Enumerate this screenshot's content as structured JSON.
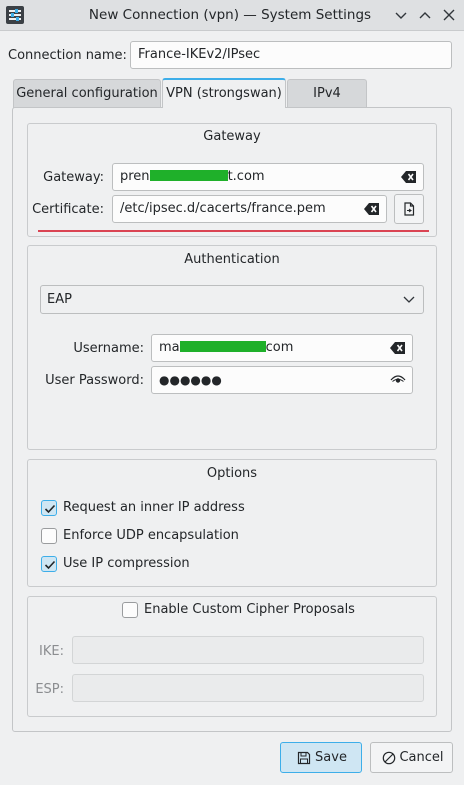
{
  "window": {
    "title": "New Connection (vpn) — System Settings",
    "icon": "system-settings-icon",
    "controls": [
      "chevron-down-icon",
      "chevron-up-icon",
      "close-icon"
    ]
  },
  "connection": {
    "label": "Connection name:",
    "value": "France-IKEv2/IPsec"
  },
  "tabs": [
    {
      "label": "General configuration",
      "active": false
    },
    {
      "label": "VPN (strongswan)",
      "active": true
    },
    {
      "label": "IPv4",
      "active": false
    }
  ],
  "gateway_group": {
    "title": "Gateway",
    "gateway_label": "Gateway:",
    "gateway_value_start": "pren",
    "gateway_value_end": "t.com",
    "certificate_label": "Certificate:",
    "certificate_value": "/etc/ipsec.d/cacerts/france.pem"
  },
  "auth_group": {
    "title": "Authentication",
    "method": "EAP",
    "username_label": "Username:",
    "username_value_start": "ma",
    "username_value_end": "com",
    "password_label": "User Password:",
    "password_value": "●●●●●●"
  },
  "options_group": {
    "title": "Options",
    "items": [
      {
        "label": "Request an inner IP address",
        "checked": true
      },
      {
        "label": "Enforce UDP encapsulation",
        "checked": false
      },
      {
        "label": "Use IP compression",
        "checked": true
      }
    ]
  },
  "cipher_group": {
    "label": "Enable Custom Cipher Proposals",
    "checked": false,
    "ike_label": "IKE:",
    "esp_label": "ESP:"
  },
  "buttons": {
    "save": "Save",
    "cancel": "Cancel"
  },
  "colors": {
    "accent": "#3daee9",
    "redaction": "#1fb02a",
    "error_line": "#da4453",
    "window_bg": "#eff0f1"
  }
}
